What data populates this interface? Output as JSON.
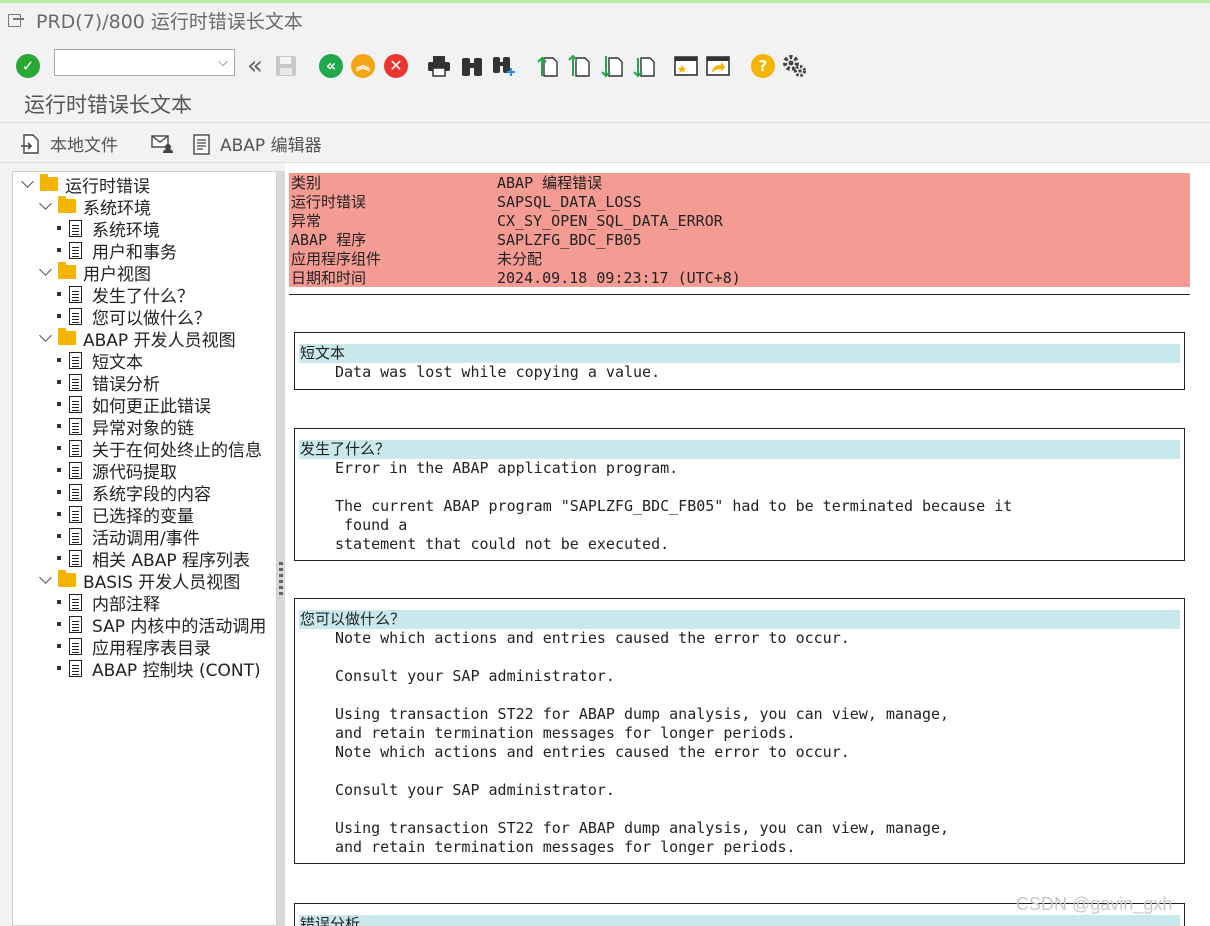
{
  "window": {
    "title": "PRD(7)/800 运行时错误长文本"
  },
  "screen_title": "运行时错误长文本",
  "command_field": {
    "value": ""
  },
  "app_toolbar": {
    "local_file": "本地文件",
    "abap_editor": "ABAP 编辑器"
  },
  "tree": [
    {
      "label": "运行时错误",
      "type": "folder",
      "level": 0
    },
    {
      "label": "系统环境",
      "type": "folder",
      "level": 1
    },
    {
      "label": "系统环境",
      "type": "doc",
      "level": 2
    },
    {
      "label": "用户和事务",
      "type": "doc",
      "level": 2
    },
    {
      "label": "用户视图",
      "type": "folder",
      "level": 1
    },
    {
      "label": "发生了什么？",
      "type": "doc",
      "level": 2
    },
    {
      "label": "您可以做什么？",
      "type": "doc",
      "level": 2
    },
    {
      "label": "ABAP 开发人员视图",
      "type": "folder",
      "level": 1
    },
    {
      "label": "短文本",
      "type": "doc",
      "level": 2
    },
    {
      "label": "错误分析",
      "type": "doc",
      "level": 2
    },
    {
      "label": "如何更正此错误",
      "type": "doc",
      "level": 2
    },
    {
      "label": "异常对象的链",
      "type": "doc",
      "level": 2
    },
    {
      "label": "关于在何处终止的信息",
      "type": "doc",
      "level": 2
    },
    {
      "label": "源代码提取",
      "type": "doc",
      "level": 2
    },
    {
      "label": "系统字段的内容",
      "type": "doc",
      "level": 2
    },
    {
      "label": "已选择的变量",
      "type": "doc",
      "level": 2
    },
    {
      "label": "活动调用/事件",
      "type": "doc",
      "level": 2
    },
    {
      "label": "相关 ABAP 程序列表",
      "type": "doc",
      "level": 2
    },
    {
      "label": "BASIS 开发人员视图",
      "type": "folder",
      "level": 1
    },
    {
      "label": "内部注释",
      "type": "doc",
      "level": 2
    },
    {
      "label": "SAP 内核中的活动调用",
      "type": "doc",
      "level": 2
    },
    {
      "label": "应用程序表目录",
      "type": "doc",
      "level": 2
    },
    {
      "label": "ABAP 控制块 (CONT)",
      "type": "doc",
      "level": 2
    }
  ],
  "header_rows": [
    {
      "key": "类别",
      "value": "ABAP 编程错误"
    },
    {
      "key": "运行时错误",
      "value": "SAPSQL_DATA_LOSS"
    },
    {
      "key": "异常",
      "value": "CX_SY_OPEN_SQL_DATA_ERROR"
    },
    {
      "key": "ABAP 程序",
      "value": "SAPLZFG_BDC_FB05"
    },
    {
      "key": "应用程序组件",
      "value": "未分配"
    },
    {
      "key": "日期和时间",
      "value": "2024.09.18 09:23:17 (UTC+8)"
    }
  ],
  "sections": [
    {
      "title": "短文本",
      "lines": [
        "Data was lost while copying a value."
      ]
    },
    {
      "title": "发生了什么？",
      "lines": [
        "Error in the ABAP application program.",
        "",
        "The current ABAP program \"SAPLZFG_BDC_FB05\" had to be terminated because it",
        " found a",
        "statement that could not be executed."
      ]
    },
    {
      "title": "您可以做什么？",
      "lines": [
        "Note which actions and entries caused the error to occur.",
        "",
        "Consult your SAP administrator.",
        "",
        "Using transaction ST22 for ABAP dump analysis, you can view, manage,",
        "and retain termination messages for longer periods.",
        "Note which actions and entries caused the error to occur.",
        "",
        "Consult your SAP administrator.",
        "",
        "Using transaction ST22 for ABAP dump analysis, you can view, manage,",
        "and retain termination messages for longer periods."
      ]
    },
    {
      "title": "错误分析",
      "lines": []
    }
  ],
  "watermark": "CSDN @gavin_gxh",
  "colors": {
    "header_row_bg": "#f49b93",
    "section_header_bg": "#c8e8ec",
    "ok_green": "#2aa836",
    "nav_green": "#20a84a",
    "nav_orange": "#f4a516",
    "cancel_red": "#e8352e",
    "help_yellow": "#f5b400"
  }
}
